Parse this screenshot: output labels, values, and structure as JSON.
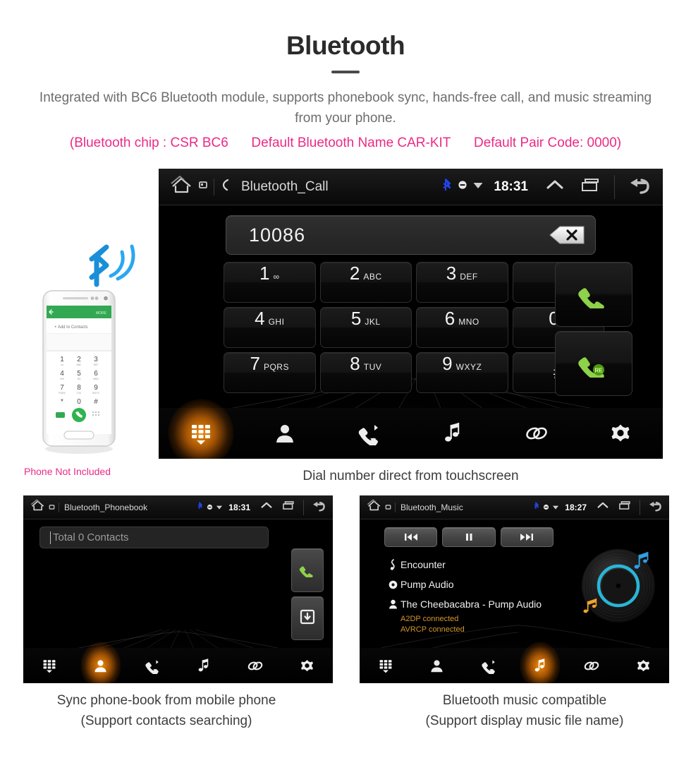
{
  "header": {
    "title": "Bluetooth",
    "subtitle": "Integrated with BC6 Bluetooth module, supports phonebook sync, hands-free call, and music streaming from your phone.",
    "spec_chip": "(Bluetooth chip : CSR BC6",
    "spec_name": "Default Bluetooth Name CAR-KIT",
    "spec_pair": "Default Pair Code: 0000)",
    "accent_pink": "#ec2a85",
    "subtitle_color": "#6d6d6d"
  },
  "phone_illustration": {
    "note": "Phone Not Included",
    "screen_action": "Add to Contacts",
    "screen_more": "MORE",
    "keys": [
      "1",
      "2",
      "3",
      "4",
      "5",
      "6",
      "7",
      "8",
      "9",
      "*",
      "0",
      "#"
    ]
  },
  "call_screen": {
    "status": {
      "title": "Bluetooth_Call",
      "clock": "18:31",
      "icons": [
        "home-icon",
        "screenshot-icon",
        "call-icon",
        "bluetooth-icon",
        "mute-icon",
        "wifi-icon",
        "chevron-up-icon",
        "recent-apps-icon",
        "back-icon"
      ],
      "bluetooth_color": "#2244ee"
    },
    "dial_value": "10086",
    "delete_label": "x",
    "keys": [
      {
        "digit": "1",
        "letters": "∞"
      },
      {
        "digit": "2",
        "letters": "ABC"
      },
      {
        "digit": "3",
        "letters": "DEF"
      },
      {
        "digit": "*",
        "letters": ""
      },
      {
        "digit": "4",
        "letters": "GHI"
      },
      {
        "digit": "5",
        "letters": "JKL"
      },
      {
        "digit": "6",
        "letters": "MNO"
      },
      {
        "digit": "0",
        "letters": "+"
      },
      {
        "digit": "7",
        "letters": "PQRS"
      },
      {
        "digit": "8",
        "letters": "TUV"
      },
      {
        "digit": "9",
        "letters": "WXYZ"
      },
      {
        "digit": "#",
        "letters": ""
      }
    ],
    "call_button": "call-icon",
    "redial_button": "redial-icon",
    "redial_badge": "RE",
    "nav": [
      {
        "name": "keypad",
        "active": true
      },
      {
        "name": "contacts",
        "active": false
      },
      {
        "name": "call-log",
        "active": false
      },
      {
        "name": "music",
        "active": false
      },
      {
        "name": "link",
        "active": false
      },
      {
        "name": "settings",
        "active": false
      }
    ],
    "caption": "Dial number direct from touchscreen"
  },
  "phonebook_screen": {
    "status": {
      "title": "Bluetooth_Phonebook",
      "clock": "18:31"
    },
    "search_value": "Total 0 Contacts",
    "side_buttons": [
      "call-icon",
      "download-icon"
    ],
    "nav": [
      {
        "name": "keypad",
        "active": false
      },
      {
        "name": "contacts",
        "active": true
      },
      {
        "name": "call-log",
        "active": false
      },
      {
        "name": "music",
        "active": false
      },
      {
        "name": "link",
        "active": false
      },
      {
        "name": "settings",
        "active": false
      }
    ],
    "caption_line1": "Sync phone-book from mobile phone",
    "caption_line2": "(Support contacts searching)"
  },
  "music_screen": {
    "status": {
      "title": "Bluetooth_Music",
      "clock": "18:27"
    },
    "transport": [
      "previous-track-icon",
      "pause-icon",
      "next-track-icon"
    ],
    "track_title": "Encounter",
    "album": "Pump Audio",
    "artist": "The Cheebacabra - Pump Audio",
    "status_a2dp": "A2DP connected",
    "status_avrcp": "AVRCP connected",
    "status_color": "#d4962b",
    "disc_accent": "#29b6d8",
    "nav": [
      {
        "name": "keypad",
        "active": false
      },
      {
        "name": "contacts",
        "active": false
      },
      {
        "name": "call-log",
        "active": false
      },
      {
        "name": "music",
        "active": true
      },
      {
        "name": "link",
        "active": false
      },
      {
        "name": "settings",
        "active": false
      }
    ],
    "caption_line1": "Bluetooth music compatible",
    "caption_line2": "(Support display music file name)"
  }
}
